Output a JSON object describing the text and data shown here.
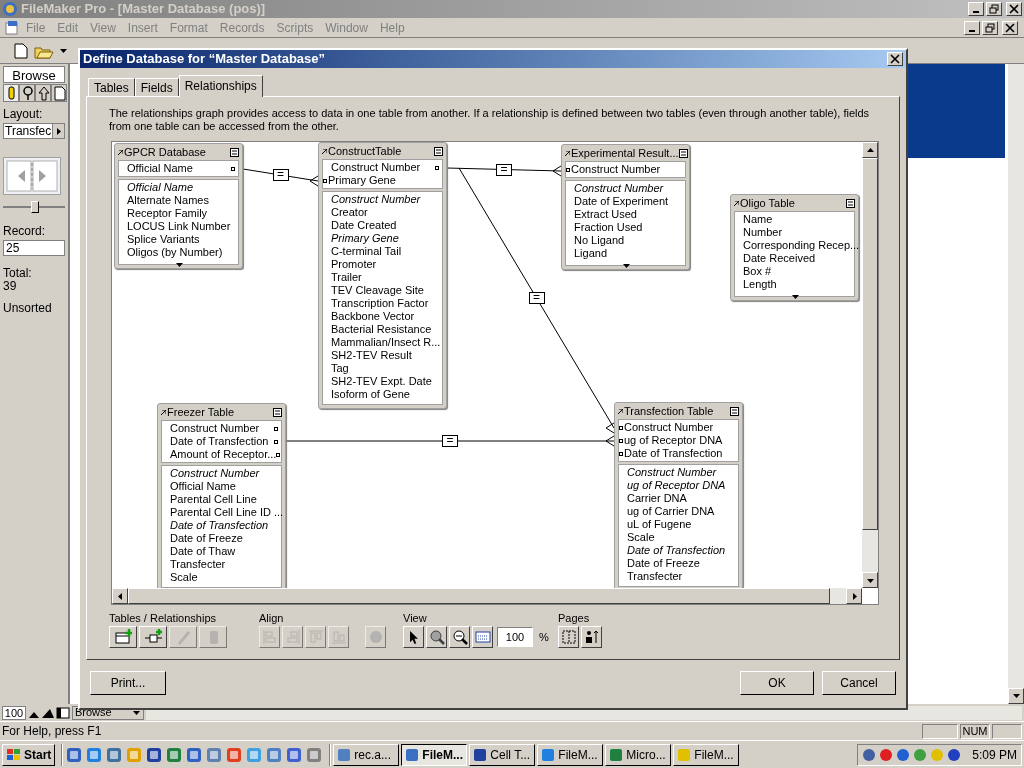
{
  "window": {
    "title": "FileMaker Pro - [Master Database (pos)]"
  },
  "menu": [
    "File",
    "Edit",
    "View",
    "Insert",
    "Format",
    "Records",
    "Scripts",
    "Window",
    "Help"
  ],
  "status_area": {
    "mode": "Browse",
    "layout_label": "Layout:",
    "layout": "Transfec",
    "level": 0.5,
    "record_label": "Record:",
    "record": "25",
    "total_label": "Total:",
    "total": "39",
    "sort_status": "Unsorted"
  },
  "dialog": {
    "title": "Define Database for “Master Database”",
    "tabs": [
      {
        "label": "Tables",
        "selected": false
      },
      {
        "label": "Fields",
        "selected": false
      },
      {
        "label": "Relationships",
        "selected": true
      }
    ],
    "description": "The relationships graph provides access to data in one table from another. If a relationship is defined between two tables (even through another table), fields from one table can be accessed from the other.",
    "tables": [
      {
        "name": "GPCR Database",
        "more_below": true,
        "keys": [
          {
            "name": "Official Name",
            "port_on_left": false
          }
        ],
        "fields": [
          {
            "name": "Official Name",
            "italic": true
          },
          {
            "name": "Alternate Names",
            "italic": false
          },
          {
            "name": "Receptor Family",
            "italic": false
          },
          {
            "name": "LOCUS Link Number",
            "italic": false
          },
          {
            "name": "Splice Variants",
            "italic": false
          },
          {
            "name": "Oligos (by Number)",
            "italic": false
          }
        ]
      },
      {
        "name": "ConstructTable",
        "more_below": false,
        "keys": [
          {
            "name": "Construct Number",
            "port_on_left": false
          },
          {
            "name": "Primary Gene",
            "port_on_left": true
          }
        ],
        "fields": [
          {
            "name": "Construct Number",
            "italic": true
          },
          {
            "name": "Creator",
            "italic": false
          },
          {
            "name": "Date Created",
            "italic": false
          },
          {
            "name": "Primary Gene",
            "italic": true
          },
          {
            "name": "C-terminal Tail",
            "italic": false
          },
          {
            "name": "Promoter",
            "italic": false
          },
          {
            "name": "Trailer",
            "italic": false
          },
          {
            "name": "TEV Cleavage Site",
            "italic": false
          },
          {
            "name": "Transcription Factor",
            "italic": false
          },
          {
            "name": "Backbone Vector",
            "italic": false
          },
          {
            "name": "Bacterial Resistance",
            "italic": false
          },
          {
            "name": "Mammalian/Insect R...",
            "italic": false
          },
          {
            "name": "SH2-TEV Result",
            "italic": false
          },
          {
            "name": "Tag",
            "italic": false
          },
          {
            "name": "SH2-TEV Expt. Date",
            "italic": false
          },
          {
            "name": "Isoform of Gene",
            "italic": false
          }
        ]
      },
      {
        "name": "Experimental Result...",
        "more_below": true,
        "keys": [
          {
            "name": "Construct Number",
            "port_on_left": true
          }
        ],
        "fields": [
          {
            "name": "Construct Number",
            "italic": true
          },
          {
            "name": "Date of Experiment",
            "italic": false
          },
          {
            "name": "Extract Used",
            "italic": false
          },
          {
            "name": "Fraction Used",
            "italic": false
          },
          {
            "name": "No Ligand",
            "italic": false
          },
          {
            "name": "Ligand",
            "italic": false
          }
        ]
      },
      {
        "name": "Oligo Table",
        "more_below": true,
        "fields": [
          {
            "name": "Name",
            "italic": false
          },
          {
            "name": "Number",
            "italic": false
          },
          {
            "name": "Corresponding Recep...",
            "italic": false
          },
          {
            "name": "Date Received",
            "italic": false
          },
          {
            "name": "Box #",
            "italic": false
          },
          {
            "name": "Length",
            "italic": false
          }
        ]
      },
      {
        "name": "Freezer Table",
        "more_below": false,
        "keys": [
          {
            "name": "Construct Number",
            "port_on_left": false
          },
          {
            "name": "Date of Transfection",
            "port_on_left": false
          },
          {
            "name": "Amount of Receptor...",
            "port_on_left": false
          }
        ],
        "fields": [
          {
            "name": "Construct Number",
            "italic": true
          },
          {
            "name": "Official Name",
            "italic": false
          },
          {
            "name": "Parental Cell Line",
            "italic": false
          },
          {
            "name": "Parental Cell Line ID ...",
            "italic": false
          },
          {
            "name": "Date of Transfection",
            "italic": true
          },
          {
            "name": "Date of Freeze",
            "italic": false
          },
          {
            "name": "Date of Thaw",
            "italic": false
          },
          {
            "name": "Transfecter",
            "italic": false
          },
          {
            "name": "Scale",
            "italic": false
          }
        ]
      },
      {
        "name": "Transfection Table",
        "more_below": false,
        "keys": [
          {
            "name": "Construct Number",
            "port_on_left": true
          },
          {
            "name": "ug of Receptor DNA",
            "port_on_left": true
          },
          {
            "name": "Date of Transfection",
            "port_on_left": true
          }
        ],
        "fields": [
          {
            "name": "Construct Number",
            "italic": true
          },
          {
            "name": "ug of Receptor DNA",
            "italic": true
          },
          {
            "name": "Carrier DNA",
            "italic": false
          },
          {
            "name": "ug of Carrier DNA",
            "italic": false
          },
          {
            "name": "uL of Fugene",
            "italic": false
          },
          {
            "name": "Scale",
            "italic": false
          },
          {
            "name": "Date of Transfection",
            "italic": true
          },
          {
            "name": "Date of Freeze",
            "italic": false
          },
          {
            "name": "Transfecter",
            "italic": false
          }
        ]
      }
    ],
    "relationships": [
      {
        "operator": "="
      },
      {
        "operator": "="
      },
      {
        "operator": "="
      },
      {
        "operator": "="
      }
    ],
    "tool_groups": [
      {
        "label": "Tables / Relationships",
        "tools": [
          {
            "kind": "add-table",
            "disabled": false
          },
          {
            "kind": "add-relationship",
            "disabled": false
          },
          {
            "kind": "edit",
            "disabled": true
          },
          {
            "kind": "delete",
            "disabled": true
          }
        ]
      },
      {
        "label": "Align",
        "tools": [
          {
            "kind": "align-left",
            "disabled": true
          },
          {
            "kind": "align-right",
            "disabled": true
          },
          {
            "kind": "align-top",
            "disabled": true
          },
          {
            "kind": "align-bottom",
            "disabled": true
          },
          {
            "kind": "color",
            "disabled": true
          }
        ]
      },
      {
        "label": "View",
        "tools": [
          {
            "kind": "pointer",
            "disabled": false
          },
          {
            "kind": "zoom-in",
            "disabled": false
          },
          {
            "kind": "zoom-out",
            "disabled": false
          },
          {
            "kind": "fit",
            "disabled": false
          }
        ]
      },
      {
        "label": "Pages",
        "tools": [
          {
            "kind": "page-breaks",
            "disabled": false
          },
          {
            "kind": "page-setup",
            "disabled": false
          }
        ]
      }
    ],
    "zoom": "100",
    "zoom_unit": "%",
    "buttons": {
      "print": "Print...",
      "ok": "OK",
      "cancel": "Cancel"
    }
  },
  "status_bar": {
    "zoom": "100",
    "mode": "Browse",
    "help": "For Help, press F1",
    "num": "NUM"
  },
  "taskbar": {
    "start": "Start",
    "tasks": [
      {
        "label": "rec.a...",
        "kind": "mail",
        "selected": false
      },
      {
        "label": "FileM...",
        "kind": "filemaker",
        "selected": true
      },
      {
        "label": "Cell T...",
        "kind": "word",
        "selected": false
      },
      {
        "label": "FileM...",
        "kind": "browser",
        "selected": false
      },
      {
        "label": "Micro...",
        "kind": "excel",
        "selected": false
      },
      {
        "label": "FileM...",
        "kind": "help",
        "selected": false
      }
    ],
    "clock": "5:09 PM"
  }
}
